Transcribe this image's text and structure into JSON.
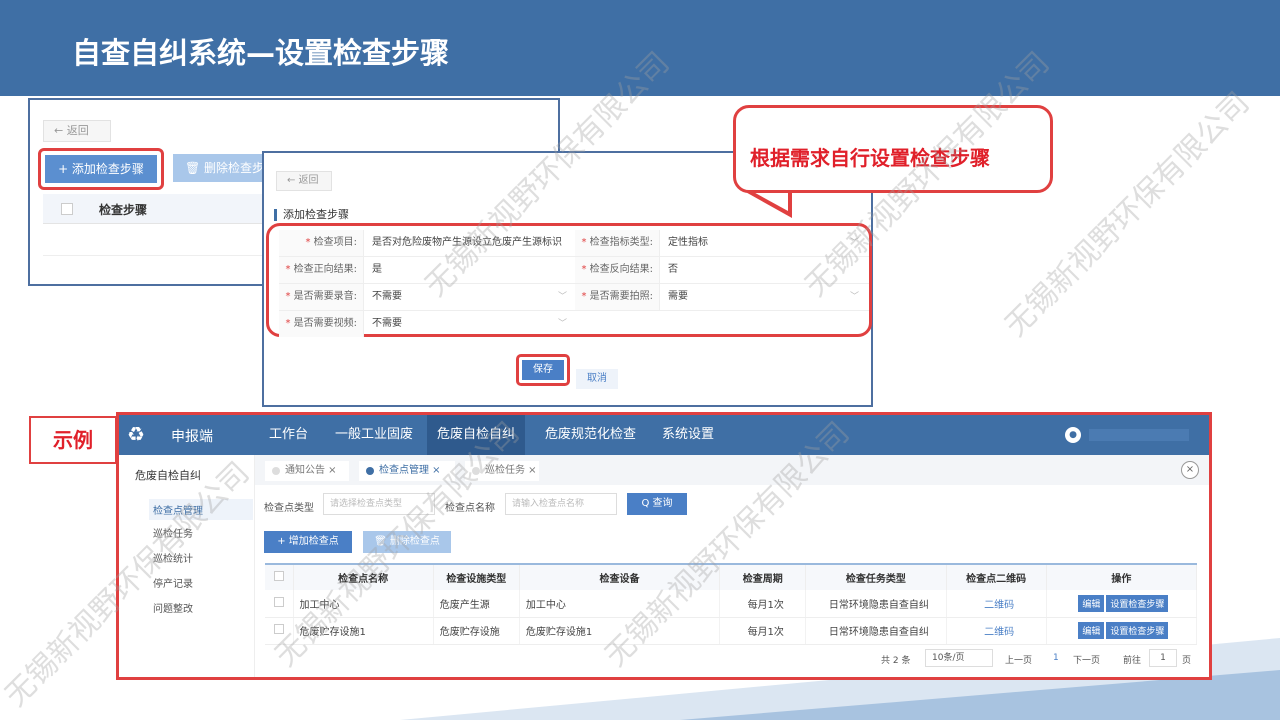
{
  "slide_title": "自查自纠系统—设置检查步骤",
  "panel1": {
    "back_label": "← 返回",
    "add_label": "+ 添加检查步骤",
    "delete_label": "🗑 删除检查步",
    "col_header": "检查步骤"
  },
  "panel2": {
    "back_label": "← 返回",
    "heading": "添加检查步骤",
    "fields": {
      "item_label": "检查项目:",
      "item_value": "是否对危险废物产生源设立危废产生源标识",
      "type_label": "检查指标类型:",
      "type_value": "定性指标",
      "pos_label": "检查正向结果:",
      "pos_value": "是",
      "neg_label": "检查反向结果:",
      "neg_value": "否",
      "record_label": "是否需要录音:",
      "record_value": "不需要",
      "photo_label": "是否需要拍照:",
      "photo_value": "需要",
      "video_label": "是否需要视频:",
      "video_value": "不需要"
    },
    "save_label": "保存",
    "cancel_label": "取消"
  },
  "callout_text": "根据需求自行设置检查步骤",
  "example_label": "示例",
  "app": {
    "brand": "申报端",
    "nav": [
      "工作台",
      "一般工业固废",
      "危废自检自纠",
      "危废规范化检查",
      "系统设置"
    ],
    "active_nav": 2,
    "sidebar_head": "危废自检自纠",
    "sidebar_items": [
      "检查点管理",
      "巡检任务",
      "巡检统计",
      "停产记录",
      "问题整改"
    ],
    "tabs": [
      "通知公告 ×",
      "检查点管理 ×",
      "巡检任务 ×"
    ],
    "filter_type_label": "检查点类型",
    "filter_type_placeholder": "请选择检查点类型",
    "filter_name_label": "检查点名称",
    "filter_name_placeholder": "请输入检查点名称",
    "query_label": "Q 查询",
    "add_point_label": "+ 增加检查点",
    "delete_point_label": "🗑 删除检查点",
    "columns": [
      "检查点名称",
      "检查设施类型",
      "检查设备",
      "检查周期",
      "检查任务类型",
      "检查点二维码",
      "操作"
    ],
    "rows": [
      {
        "name": "加工中心",
        "facility": "危废产生源",
        "device": "加工中心",
        "cycle": "每月1次",
        "task": "日常环境隐患自查自纠",
        "qr": "二维码"
      },
      {
        "name": "危废贮存设施1",
        "facility": "危废贮存设施",
        "device": "危废贮存设施1",
        "cycle": "每月1次",
        "task": "日常环境隐患自查自纠",
        "qr": "二维码"
      }
    ],
    "op_edit": "编辑",
    "op_steps": "设置检查步骤",
    "pager": {
      "total": "共 2 条",
      "page_size": "10条/页",
      "prev": "上一页",
      "current": "1",
      "next": "下一页",
      "goto": "前往",
      "goto_value": "1",
      "page_unit": "页"
    }
  },
  "watermark": "无锡新视野环保有限公司"
}
